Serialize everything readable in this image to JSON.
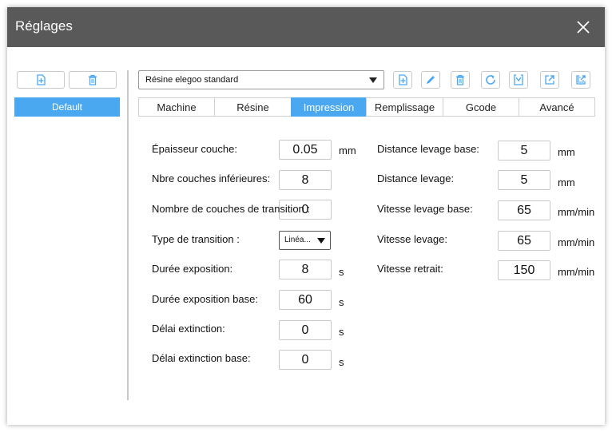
{
  "window": {
    "title": "Réglages"
  },
  "profiles": {
    "items": [
      {
        "label": "Default"
      }
    ]
  },
  "material": {
    "selected": "Résine elegoo standard"
  },
  "tabs": [
    {
      "label": "Machine"
    },
    {
      "label": "Résine"
    },
    {
      "label": "Impression"
    },
    {
      "label": "Remplissage"
    },
    {
      "label": "Gcode"
    },
    {
      "label": "Avancé"
    }
  ],
  "left": {
    "layer_height": {
      "label": "Épaisseur couche:",
      "value": "0.05",
      "unit": "mm"
    },
    "bottom_layers": {
      "label": "Nbre couches inférieures:",
      "value": "8"
    },
    "transition_layers": {
      "label": "Nombre de couches de transition :",
      "value": "0"
    },
    "transition_type": {
      "label": "Type de transition :",
      "value": "Linéa..."
    },
    "exposure": {
      "label": "Durée exposition:",
      "value": "8",
      "unit": "s"
    },
    "bottom_exposure": {
      "label": "Durée exposition base:",
      "value": "60",
      "unit": "s"
    },
    "light_off": {
      "label": "Délai extinction:",
      "value": "0",
      "unit": "s"
    },
    "bottom_light_off": {
      "label": "Délai extinction base:",
      "value": "0",
      "unit": "s"
    }
  },
  "right": {
    "bottom_lift_distance": {
      "label": "Distance levage base:",
      "value": "5",
      "unit": "mm"
    },
    "lift_distance": {
      "label": "Distance levage:",
      "value": "5",
      "unit": "mm"
    },
    "bottom_lift_speed": {
      "label": "Vitesse levage base:",
      "value": "65",
      "unit": "mm/min"
    },
    "lift_speed": {
      "label": "Vitesse levage:",
      "value": "65",
      "unit": "mm/min"
    },
    "retract_speed": {
      "label": "Vitesse retrait:",
      "value": "150",
      "unit": "mm/min"
    }
  },
  "colors": {
    "accent": "#4aa8f0",
    "titlebar": "#595959",
    "icon": "#4aa8f0"
  }
}
